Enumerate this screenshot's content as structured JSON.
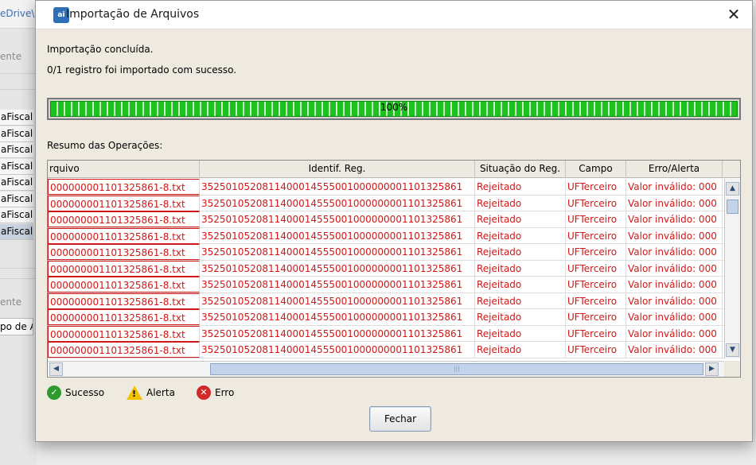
{
  "background": {
    "path_fragment": "eDrive\\",
    "faded_text_1": "ente",
    "items": [
      "aFiscal",
      "aFiscal",
      "aFiscal",
      "aFiscal",
      "aFiscal",
      "aFiscal",
      "aFiscal",
      "aFiscal"
    ],
    "faded_text_2": "ente",
    "field_text": "po de A"
  },
  "dialog": {
    "title": "Importação de Arquivos",
    "app_icon_text": "ai",
    "close_glyph": "✕",
    "status_line1": "Importação concluída.",
    "status_line2": "0/1 registro foi importado com sucesso.",
    "progress": {
      "value_percent": 100,
      "label": "100%"
    },
    "summary_label": "Resumo das Operações:",
    "table": {
      "columns": [
        "rquivo",
        "Identif. Reg.",
        "Situação do Reg.",
        "Campo",
        "Erro/Alerta"
      ],
      "rows": [
        [
          "000000001101325861-8.txt",
          "3525010520811400014555001000000001101325861",
          "Rejeitado",
          "UFTerceiro",
          "Valor inválido: 000"
        ],
        [
          "000000001101325861-8.txt",
          "3525010520811400014555001000000001101325861",
          "Rejeitado",
          "UFTerceiro",
          "Valor inválido: 000"
        ],
        [
          "000000001101325861-8.txt",
          "3525010520811400014555001000000001101325861",
          "Rejeitado",
          "UFTerceiro",
          "Valor inválido: 000"
        ],
        [
          "000000001101325861-8.txt",
          "3525010520811400014555001000000001101325861",
          "Rejeitado",
          "UFTerceiro",
          "Valor inválido: 000"
        ],
        [
          "000000001101325861-8.txt",
          "3525010520811400014555001000000001101325861",
          "Rejeitado",
          "UFTerceiro",
          "Valor inválido: 000"
        ],
        [
          "000000001101325861-8.txt",
          "3525010520811400014555001000000001101325861",
          "Rejeitado",
          "UFTerceiro",
          "Valor inválido: 000"
        ],
        [
          "000000001101325861-8.txt",
          "3525010520811400014555001000000001101325861",
          "Rejeitado",
          "UFTerceiro",
          "Valor inválido: 000"
        ],
        [
          "000000001101325861-8.txt",
          "3525010520811400014555001000000001101325861",
          "Rejeitado",
          "UFTerceiro",
          "Valor inválido: 000"
        ],
        [
          "000000001101325861-8.txt",
          "3525010520811400014555001000000001101325861",
          "Rejeitado",
          "UFTerceiro",
          "Valor inválido: 000"
        ],
        [
          "000000001101325861-8.txt",
          "3525010520811400014555001000000001101325861",
          "Rejeitado",
          "UFTerceiro",
          "Valor inválido: 000"
        ],
        [
          "000000001101325861-8.txt",
          "3525010520811400014555001000000001101325861",
          "Rejeitado",
          "UFTerceiro",
          "Valor inválido: 000"
        ]
      ],
      "row_text_color": "#d01818"
    },
    "legend": {
      "success": "Sucesso",
      "warning": "Alerta",
      "error": "Erro",
      "icons": [
        "check-circle-icon",
        "warning-triangle-icon",
        "x-circle-icon"
      ]
    },
    "close_button": "Fechar"
  },
  "colors": {
    "progress_green": "#1ec11e",
    "error_red": "#d01818",
    "dialog_bg": "#eeeae0"
  }
}
